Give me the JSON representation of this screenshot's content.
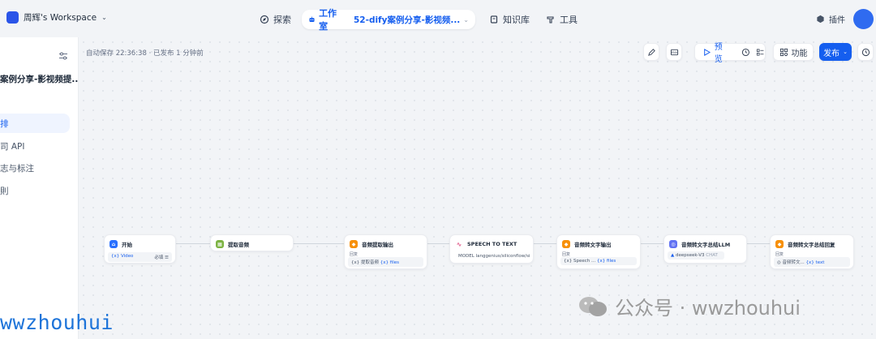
{
  "header": {
    "workspace": "周辉's Workspace",
    "nav": {
      "explore": "探索",
      "studio": "工作室",
      "app_name": "52-dify案例分享-影视频...",
      "knowledge": "知识库",
      "tools": "工具"
    },
    "plugins": "插件"
  },
  "sidebar": {
    "app_title": "案例分享-影视频提...",
    "items": [
      {
        "label": "排",
        "active": true
      },
      {
        "label": "司 API",
        "active": false
      },
      {
        "label": "志与标注",
        "active": false
      },
      {
        "label": "則",
        "active": false
      }
    ]
  },
  "canvas": {
    "autosave": "自动保存 22:36:38 · 已发布 1 分钟前",
    "toolbar": {
      "preview": "预览",
      "features": "功能",
      "publish": "发布"
    },
    "nodes": [
      {
        "title": "开始",
        "icon_color": "#2970ff",
        "var": "{x} Video",
        "meta": "必填 ☰"
      },
      {
        "title": "提取音频",
        "icon_color": "#7cb342"
      },
      {
        "title": "音频提取输出",
        "icon_color": "#f79009",
        "label": "回复",
        "var": "{x} 提取音频",
        "tag": "{x} files"
      },
      {
        "title": "SPEECH TO TEXT",
        "icon_color": "#e25e8d",
        "model": "MODEL langgenius/siliconflow/sili..."
      },
      {
        "title": "音频转文字输出",
        "icon_color": "#f79009",
        "label": "回复",
        "var": "{x} Speech ...",
        "tag": "{x} files"
      },
      {
        "title": "音频转文字总结LLM",
        "icon_color": "#6172f3",
        "model": "deepseek-V3",
        "mode": "CHAT"
      },
      {
        "title": "音频转文字总结回复",
        "icon_color": "#f79009",
        "label": "回复",
        "var": "◎ 音频转文...",
        "tag": "{x} text"
      }
    ]
  },
  "watermarks": {
    "wechat": "公众号 · wwzhouhui",
    "left": "wwzhouhui"
  }
}
